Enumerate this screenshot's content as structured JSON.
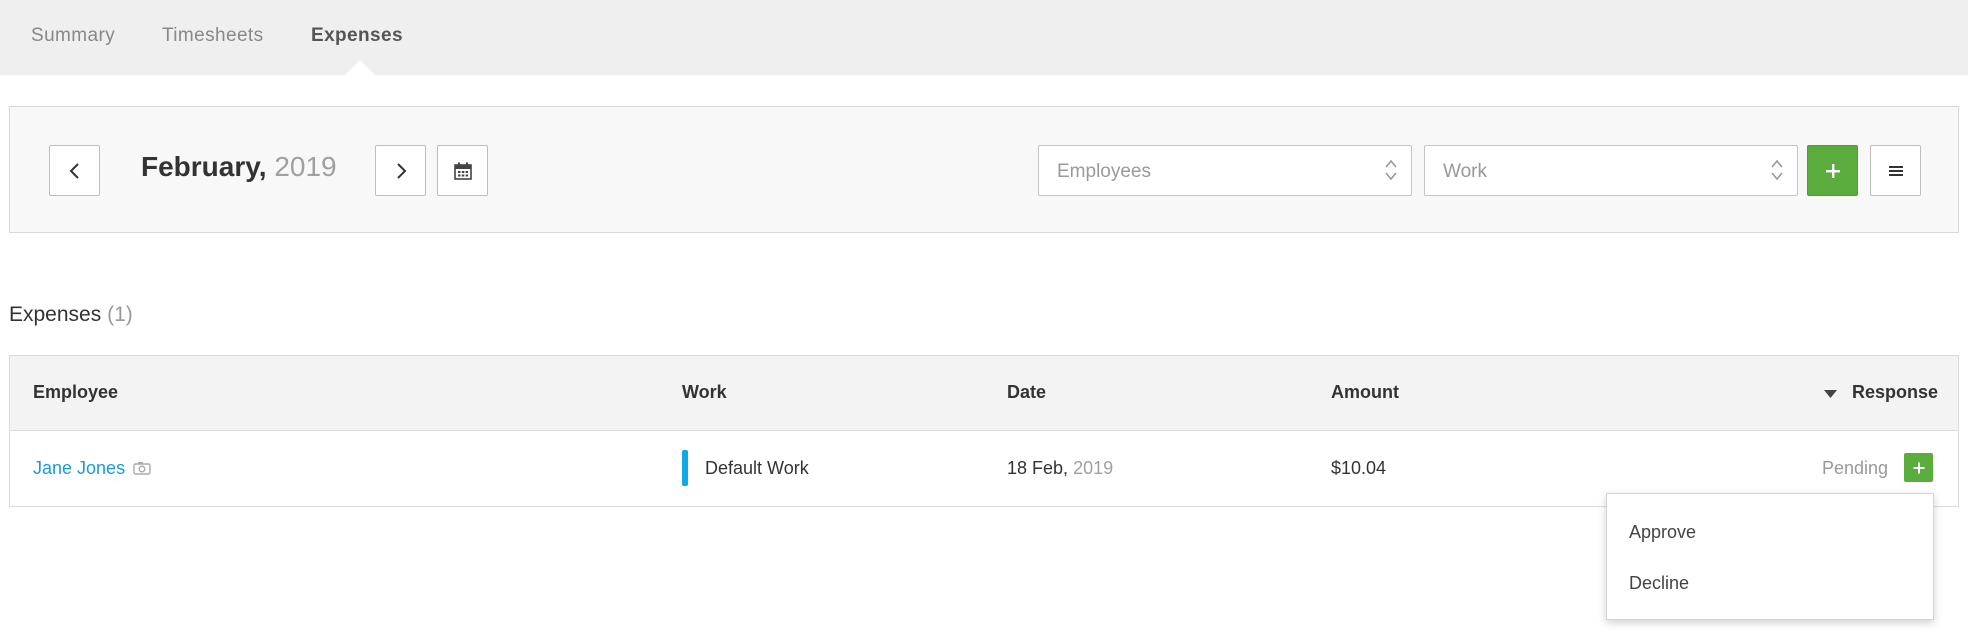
{
  "tabs": [
    {
      "label": "Summary",
      "active": false
    },
    {
      "label": "Timesheets",
      "active": false
    },
    {
      "label": "Expenses",
      "active": true
    }
  ],
  "toolbar": {
    "prev_icon": "chevron-left-icon",
    "next_icon": "chevron-right-icon",
    "calendar_icon": "calendar-icon",
    "month": "February,",
    "year": "2019",
    "employees_select": {
      "placeholder": "Employees"
    },
    "work_select": {
      "placeholder": "Work"
    },
    "add_icon": "plus-icon",
    "menu_icon": "hamburger-menu-icon"
  },
  "section": {
    "title": "Expenses",
    "count": "(1)"
  },
  "table": {
    "columns": {
      "employee": "Employee",
      "work": "Work",
      "date": "Date",
      "amount": "Amount",
      "response": "Response"
    },
    "sort_icon": "caret-down-icon",
    "rows": [
      {
        "employee": "Jane Jones",
        "employee_icon": "camera-icon",
        "work": "Default Work",
        "work_color": "#11a9e6",
        "date_day": "18 Feb,",
        "date_year": "2019",
        "amount": "$10.04",
        "response": "Pending"
      }
    ]
  },
  "dropdown": {
    "items": [
      "Approve",
      "Decline"
    ]
  },
  "colors": {
    "accent_green": "#5aad3c",
    "link_blue": "#1a9ad6",
    "work_blue": "#11a9e6"
  }
}
